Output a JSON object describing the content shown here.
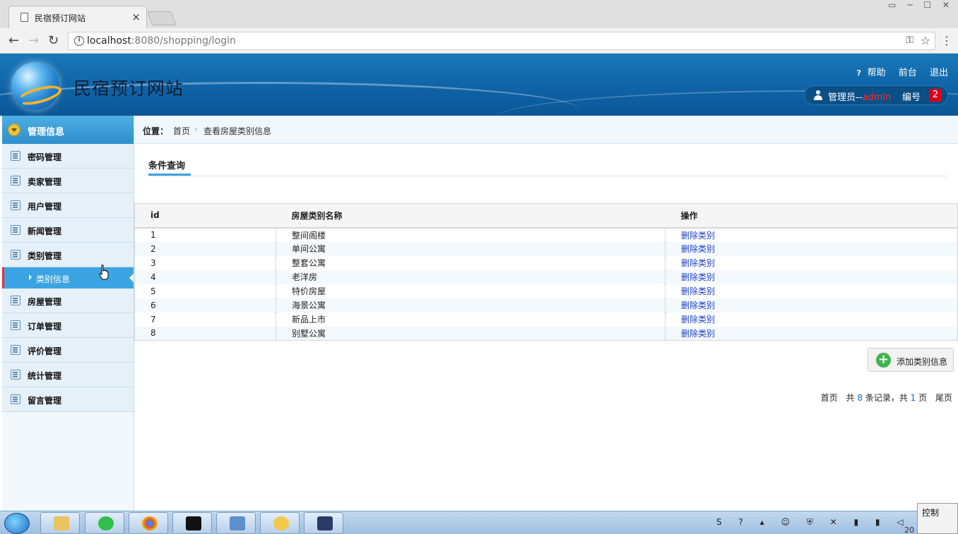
{
  "browser": {
    "tab_title": "民宿预订网站",
    "url_host": "localhost",
    "url_rest": ":8080/shopping/login"
  },
  "header": {
    "site_title": "民宿预订网站",
    "help": "帮助",
    "front": "前台",
    "logout": "退出",
    "user_role": "管理员--",
    "user_name": "admin",
    "num_label": "编号",
    "num_value": "2"
  },
  "sidebar": {
    "heading": "管理信息",
    "items_top": [
      {
        "label": "密码管理"
      },
      {
        "label": "卖家管理"
      },
      {
        "label": "用户管理"
      },
      {
        "label": "新闻管理"
      },
      {
        "label": "类别管理"
      }
    ],
    "sub_item": "类别信息",
    "items_bottom": [
      {
        "label": "房屋管理"
      },
      {
        "label": "订单管理"
      },
      {
        "label": "评价管理"
      },
      {
        "label": "统计管理"
      },
      {
        "label": "留言管理"
      }
    ]
  },
  "breadcrumb": {
    "label": "位置：",
    "home": "首页",
    "sep": "›",
    "current": "查看房屋类别信息"
  },
  "query_tab": "条件查询",
  "table": {
    "headers": [
      "id",
      "房屋类别名称",
      "操作"
    ],
    "rows": [
      {
        "id": "1",
        "name": "整间阁楼",
        "op": "删除类别"
      },
      {
        "id": "2",
        "name": "单间公寓",
        "op": "删除类别"
      },
      {
        "id": "3",
        "name": "整套公寓",
        "op": "删除类别"
      },
      {
        "id": "4",
        "name": "老洋房",
        "op": "删除类别"
      },
      {
        "id": "5",
        "name": "特价房屋",
        "op": "删除类别"
      },
      {
        "id": "6",
        "name": "海景公寓",
        "op": "删除类别"
      },
      {
        "id": "7",
        "name": "新品上市",
        "op": "删除类别"
      },
      {
        "id": "8",
        "name": "别墅公寓",
        "op": "删除类别"
      }
    ]
  },
  "add_button": "添加类别信息",
  "pager": {
    "first": "首页",
    "prefix": "共",
    "records": "8",
    "records_suffix": "条记录，共",
    "pages": "1",
    "pages_suffix": "页",
    "last": "尾页"
  },
  "taskbar": {
    "clock": "20",
    "control_popup": "控制"
  }
}
